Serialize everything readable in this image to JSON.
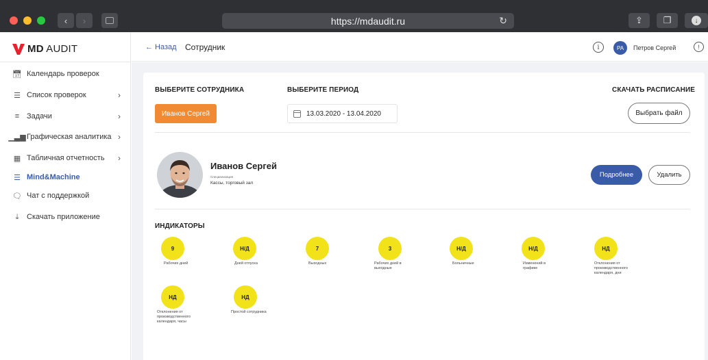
{
  "browser": {
    "url": "https://mdaudit.ru",
    "colors": {
      "close": "#fe5f57",
      "minimize": "#febc2e",
      "maximize": "#28c840"
    }
  },
  "logo": {
    "bold": "MD",
    "light": "AUDIT",
    "color": "#e8212e"
  },
  "sidebar": {
    "items": [
      {
        "label": "Календарь проверок",
        "icon": "calendar-icon",
        "chevron": false
      },
      {
        "label": "Список проверок",
        "icon": "checklist-icon",
        "chevron": true
      },
      {
        "label": "Задачи",
        "icon": "tasks-icon",
        "chevron": true
      },
      {
        "label": "Графическая аналитика",
        "icon": "bar-chart-icon",
        "chevron": true
      },
      {
        "label": "Табличная отчетность",
        "icon": "table-icon",
        "chevron": true
      },
      {
        "label": "Mind&Machine",
        "icon": "server-icon",
        "chevron": false,
        "active": true
      },
      {
        "label": "Чат с поддержкой",
        "icon": "chat-icon",
        "chevron": false
      },
      {
        "label": "Скачать приложение",
        "icon": "download-icon",
        "chevron": false
      }
    ]
  },
  "topbar": {
    "back_label": "← Назад",
    "title": "Сотрудник",
    "user_initials": "PA",
    "user_name": "Петров Сергей"
  },
  "employee_select": {
    "title": "ВЫБЕРИТЕ СОТРУДНИКА",
    "value": "Иванов Сергей"
  },
  "period_select": {
    "title": "ВЫБЕРИТЕ ПЕРИОД",
    "value": "13.03.2020 - 13.04.2020"
  },
  "schedule": {
    "title": "СКАЧАТЬ РАСПИСАНИЕ",
    "button": "Выбрать файл"
  },
  "employee": {
    "name": "Иванов Сергей",
    "spec_label": "Специализация",
    "spec": "Кассы, торговый зал",
    "more_button": "Подробнее",
    "delete_button": "Удалить"
  },
  "indicators": {
    "title": "ИНДИКАТОРЫ",
    "color": "#f2e219",
    "items": [
      {
        "value": "9",
        "label": "Рабочих дней"
      },
      {
        "value": "Н/Д",
        "label": "Дней отпуска"
      },
      {
        "value": "7",
        "label": "Выходных"
      },
      {
        "value": "3",
        "label": "Рабочих дней в выходные"
      },
      {
        "value": "Н/Д",
        "label": "Больничные"
      },
      {
        "value": "Н/Д",
        "label": "Изменений в графике"
      },
      {
        "value": "НД",
        "label": "Отклонения от производственного календаря, дни"
      },
      {
        "value": "НД",
        "label": "Отклонения от производственного календаря, часы"
      },
      {
        "value": "НД",
        "label": "Простой сотрудника"
      }
    ]
  }
}
